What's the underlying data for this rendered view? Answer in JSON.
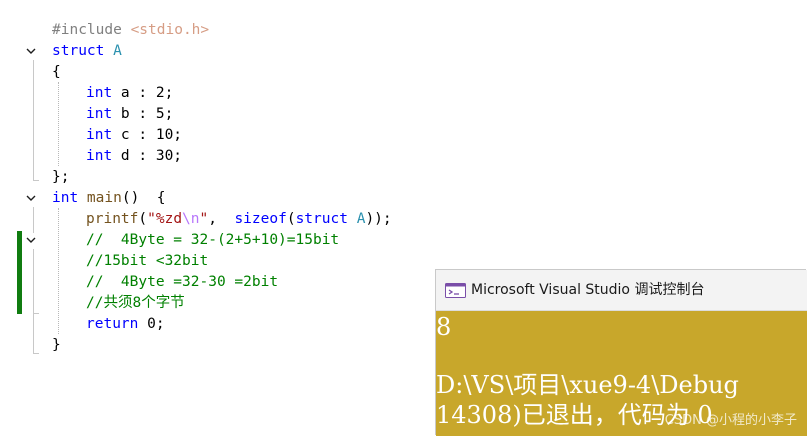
{
  "editor": {
    "lines": {
      "l1": {
        "text": "#include ",
        "header": "<stdio.h>"
      },
      "l2": {
        "kw": "struct",
        "name": "A"
      },
      "l3": {
        "text": "{"
      },
      "l4": {
        "kw": "int",
        "rest": " a : 2;"
      },
      "l5": {
        "kw": "int",
        "rest": " b : 5;"
      },
      "l6": {
        "kw": "int",
        "rest": " c : 10;"
      },
      "l7": {
        "kw": "int",
        "rest": " d : 30;"
      },
      "l8": {
        "text": "};"
      },
      "l9": {
        "kw": "int",
        "fn": " main",
        "rest": "()  {"
      },
      "l10": {
        "fn": "printf",
        "p1": "(",
        "str1": "\"%zd",
        "esc": "\\n",
        "str2": "\"",
        "p2": ",  ",
        "kw1": "sizeof",
        "p3": "(",
        "kw2": "struct",
        "p4": " ",
        "type": "A",
        "p5": "));"
      },
      "l11": {
        "text": "//  4Byte = 32-(2+5+10)=15bit"
      },
      "l12": {
        "text": "//15bit <32bit"
      },
      "l13": {
        "text": "//  4Byte =32-30 =2bit"
      },
      "l14": {
        "text": "//共须8个字节"
      },
      "l15": {
        "kw": "return",
        "rest": " 0;"
      },
      "l16": {
        "text": "}"
      }
    }
  },
  "console": {
    "title": "Microsoft Visual Studio 调试控制台",
    "output": [
      "8",
      "",
      "D:\\VS\\项目\\xue9-4\\Debug",
      "14308)已退出，代码为 0"
    ],
    "body_color": "#c8a72b",
    "icon": "console-window-icon"
  },
  "watermark": "CSDN @小程的小李子",
  "colors": {
    "keyword": "#0000ff",
    "type": "#2b91af",
    "comment": "#008000",
    "string": "#a31515",
    "change_bar": "#107c10"
  }
}
